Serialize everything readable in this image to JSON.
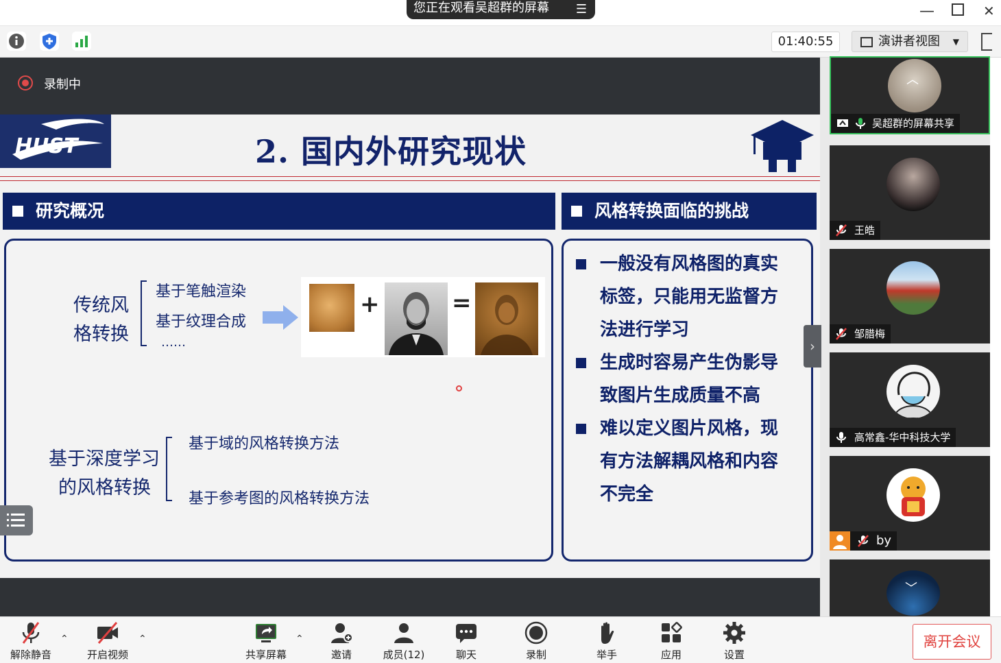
{
  "titlebar": {
    "share_banner": "您正在观看吴超群的屏幕",
    "menu_glyph": "☰"
  },
  "subbar": {
    "timer": "01:40:55",
    "view_label": "演讲者视图"
  },
  "stage": {
    "recording_label": "录制中"
  },
  "slide": {
    "logo_text": "HUST",
    "title": "2. 国内外研究现状",
    "left_section": {
      "heading": "研究概况",
      "traditional": {
        "label": "传统风格转换",
        "label_line1": "传统风",
        "label_line2": "格转换",
        "items": [
          "基于笔触渲染",
          "基于纹理合成",
          "……"
        ]
      },
      "deep": {
        "label_line1": "基于深度学习",
        "label_line2": "的风格转换",
        "items": [
          "基于域的风格转换方法",
          "基于参考图的风格转换方法"
        ]
      },
      "equation": {
        "plus": "+",
        "equals": "="
      }
    },
    "right_section": {
      "heading": "风格转换面临的挑战",
      "bullets": [
        "一般没有风格图的真实标签，只能用无监督方法进行学习",
        "生成时容易产生伪影导致图片生成质量不高",
        "难以定义图片风格，现有方法解耦风格和内容不完全"
      ]
    }
  },
  "participants": [
    {
      "name": "吴超群的屏幕共享",
      "status": "sharing"
    },
    {
      "name": "王皓",
      "status": "muted"
    },
    {
      "name": "邹腊梅",
      "status": "muted"
    },
    {
      "name": "高常鑫-华中科技大学",
      "status": "unmuted"
    },
    {
      "name": "by",
      "status": "muted"
    }
  ],
  "bottombar": {
    "unmute": "解除静音",
    "start_video": "开启视频",
    "share_screen": "共享屏幕",
    "invite": "邀请",
    "members": "成员(12)",
    "chat": "聊天",
    "record": "录制",
    "raise_hand": "举手",
    "apps": "应用",
    "settings": "设置",
    "leave": "离开会议"
  },
  "colors": {
    "navy": "#0d2266",
    "stage_bg": "#2f3236",
    "leave_red": "#e0433f",
    "active_green": "#37c35c"
  }
}
